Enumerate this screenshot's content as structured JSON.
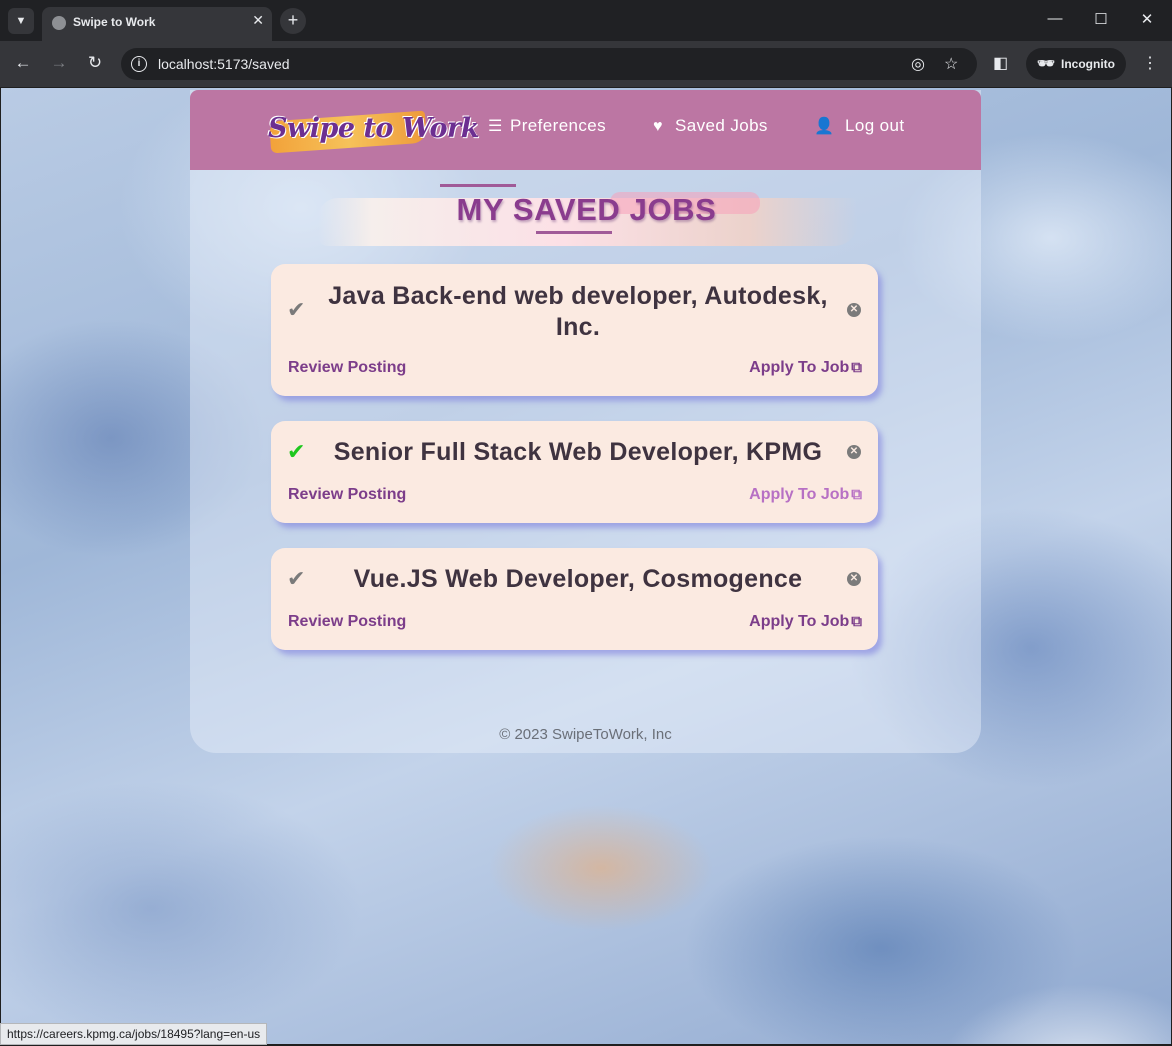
{
  "browser": {
    "tab_title": "Swipe to Work",
    "url": "localhost:5173/saved",
    "profile_label": "Incognito",
    "status_url": "https://careers.kpmg.ca/jobs/18495?lang=en-us"
  },
  "nav": {
    "logo_text": "Swipe to Work",
    "preferences": "Preferences",
    "saved_jobs": "Saved Jobs",
    "logout": "Log out"
  },
  "page": {
    "title": "MY SAVED JOBS",
    "footer": "© 2023 SwipeToWork, Inc"
  },
  "jobs": [
    {
      "title": "Java Back-end web developer, Autodesk, Inc.",
      "review": "Review Posting",
      "apply": "Apply To Job",
      "applied": false
    },
    {
      "title": "Senior Full Stack Web Developer, KPMG",
      "review": "Review Posting",
      "apply": "Apply To Job",
      "applied": true
    },
    {
      "title": "Vue.JS Web Developer, Cosmogence",
      "review": "Review Posting",
      "apply": "Apply To Job",
      "applied": false
    }
  ],
  "colors": {
    "navbar": "#bc76a3",
    "heading": "#8a3c8e",
    "card": "#fbeae1",
    "link": "#7c3d8a",
    "applied_check": "#1ec71e"
  }
}
